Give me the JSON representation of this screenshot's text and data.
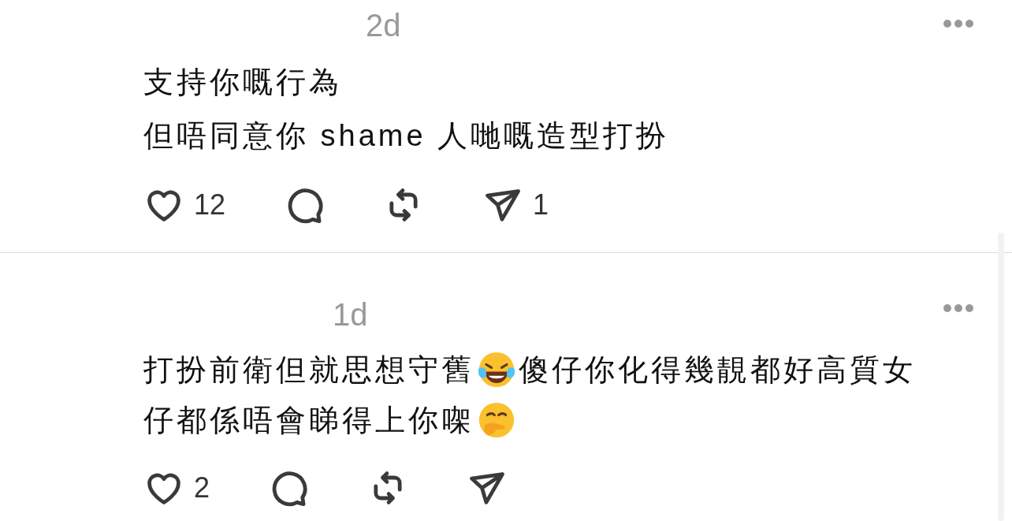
{
  "comments": [
    {
      "time": "2d",
      "lines": [
        [
          {
            "kind": "text",
            "text": "支持你嘅行為"
          }
        ],
        [
          {
            "kind": "text",
            "text": "但唔同意你 shame 人哋嘅造型打扮"
          }
        ]
      ],
      "actions": [
        {
          "kind": "like",
          "count": "12"
        },
        {
          "kind": "reply"
        },
        {
          "kind": "repost"
        },
        {
          "kind": "share",
          "count": "1"
        }
      ]
    },
    {
      "time": "1d",
      "lines": [
        [
          {
            "kind": "text",
            "text": "打扮前衛但就思想守舊"
          },
          {
            "kind": "laughing"
          },
          {
            "kind": "text",
            "text": "傻仔你化得幾靚都好高質女"
          }
        ],
        [
          {
            "kind": "text",
            "text": "仔都係唔會睇得上你㗎"
          },
          {
            "kind": "hush"
          }
        ]
      ],
      "actions": [
        {
          "kind": "like",
          "count": "2"
        },
        {
          "kind": "reply"
        },
        {
          "kind": "repost"
        },
        {
          "kind": "share"
        }
      ]
    }
  ]
}
